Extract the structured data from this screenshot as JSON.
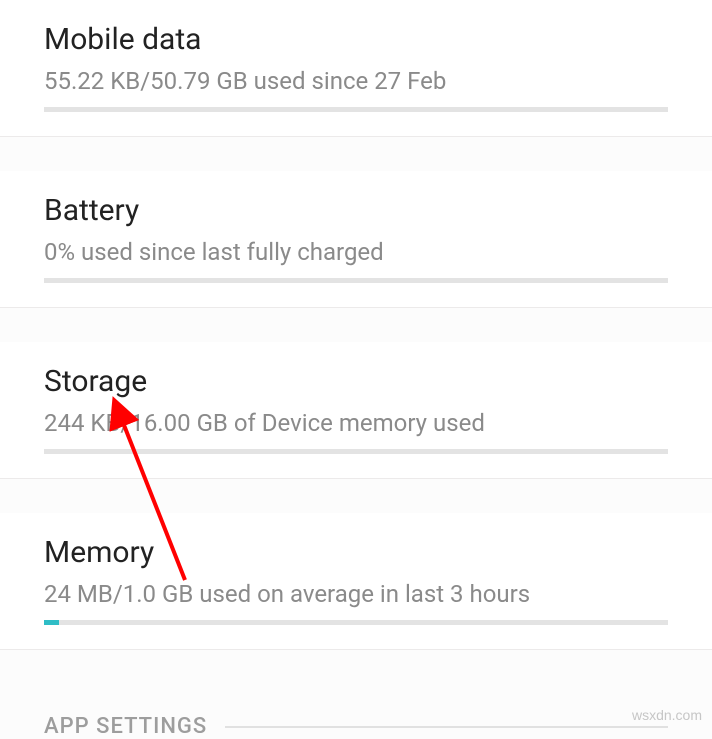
{
  "items": [
    {
      "title": "Mobile data",
      "subtitle": "55.22 KB/50.79 GB used since 27 Feb",
      "progress_pct": 0
    },
    {
      "title": "Battery",
      "subtitle": "0% used since last fully charged",
      "progress_pct": 0
    },
    {
      "title": "Storage",
      "subtitle": "244 KB/16.00 GB of Device memory used",
      "progress_pct": 0
    },
    {
      "title": "Memory",
      "subtitle": "24 MB/1.0 GB used on average in last 3 hours",
      "progress_pct": 2.4
    }
  ],
  "section_header": "APP SETTINGS",
  "watermark": "wsxdn.com"
}
